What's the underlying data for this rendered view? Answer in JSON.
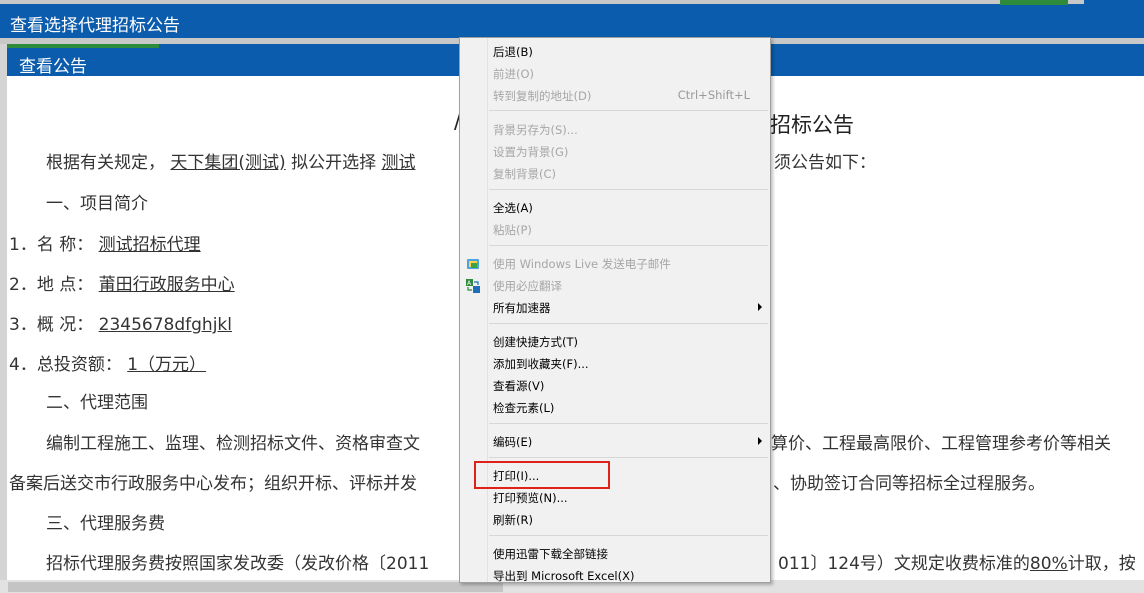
{
  "window": {
    "title": "查看选择代理招标公告"
  },
  "panel": {
    "title": "查看公告"
  },
  "document": {
    "title_partial_left": "/",
    "title_partial_right": "招标公告",
    "intro_prefix": "根据有关规定，",
    "intro_company": "天下集团(测试)",
    "intro_mid": "拟公开选择",
    "intro_project": "测试",
    "intro_suffix": "须公告如下：",
    "section1": "一、项目简介",
    "item1_label": "1．名  称：",
    "item1_value": "测试招标代理",
    "item2_label": "2．地  点：",
    "item2_value": "莆田行政服务中心",
    "item3_label": "3．概  况：",
    "item3_value": "2345678dfghjkl",
    "item4_label": "4．总投资额：",
    "item4_value": "1（万元）",
    "section2": "二、代理范围",
    "scope_line1_left": "编制工程施工、监理、检测招标文件、资格审查文",
    "scope_line1_right": "算价、工程最高限价、工程管理参考价等相关",
    "scope_line2_left": "备案后送交市行政服务中心发布；组织开标、评标并发",
    "scope_line2_right": "、协助签订合同等招标全过程服务。",
    "section3": "三、代理服务费",
    "fee_line_left": "招标代理服务费按照国家发改委（发改价格〔2011",
    "fee_line_right_a": "011〕124号）文规定收费标准的",
    "fee_line_percent": "80%",
    "fee_line_right_b": "计取，按"
  },
  "context_menu": {
    "items": [
      {
        "label": "后退(B)",
        "shortcut": "",
        "disabled": false
      },
      {
        "label": "前进(O)",
        "shortcut": "",
        "disabled": true
      },
      {
        "label": "转到复制的地址(D)",
        "shortcut": "Ctrl+Shift+L",
        "disabled": true
      },
      {
        "label": "背景另存为(S)...",
        "shortcut": "",
        "disabled": true
      },
      {
        "label": "设置为背景(G)",
        "shortcut": "",
        "disabled": true
      },
      {
        "label": "复制背景(C)",
        "shortcut": "",
        "disabled": true
      },
      {
        "label": "全选(A)",
        "shortcut": "",
        "disabled": false
      },
      {
        "label": "粘贴(P)",
        "shortcut": "",
        "disabled": true
      },
      {
        "label": "使用 Windows Live 发送电子邮件",
        "shortcut": "",
        "disabled": true,
        "icon": "windows-live-icon"
      },
      {
        "label": "使用必应翻译",
        "shortcut": "",
        "disabled": true,
        "icon": "bing-translate-icon"
      },
      {
        "label": "所有加速器",
        "shortcut": "",
        "disabled": false,
        "submenu": true
      },
      {
        "label": "创建快捷方式(T)",
        "shortcut": "",
        "disabled": false
      },
      {
        "label": "添加到收藏夹(F)...",
        "shortcut": "",
        "disabled": false
      },
      {
        "label": "查看源(V)",
        "shortcut": "",
        "disabled": false
      },
      {
        "label": "检查元素(L)",
        "shortcut": "",
        "disabled": false
      },
      {
        "label": "编码(E)",
        "shortcut": "",
        "disabled": false,
        "submenu": true
      },
      {
        "label": "打印(I)...",
        "shortcut": "",
        "disabled": false,
        "highlighted": true
      },
      {
        "label": "打印预览(N)...",
        "shortcut": "",
        "disabled": false
      },
      {
        "label": "刷新(R)",
        "shortcut": "",
        "disabled": false
      },
      {
        "label": "使用迅雷下载全部链接",
        "shortcut": "",
        "disabled": false
      },
      {
        "label": "导出到 Microsoft Excel(X)",
        "shortcut": "",
        "disabled": false
      }
    ]
  },
  "colors": {
    "header_blue": "#0b5cad",
    "accent_green": "#2e8b3c",
    "highlight_red": "#e0201a"
  }
}
